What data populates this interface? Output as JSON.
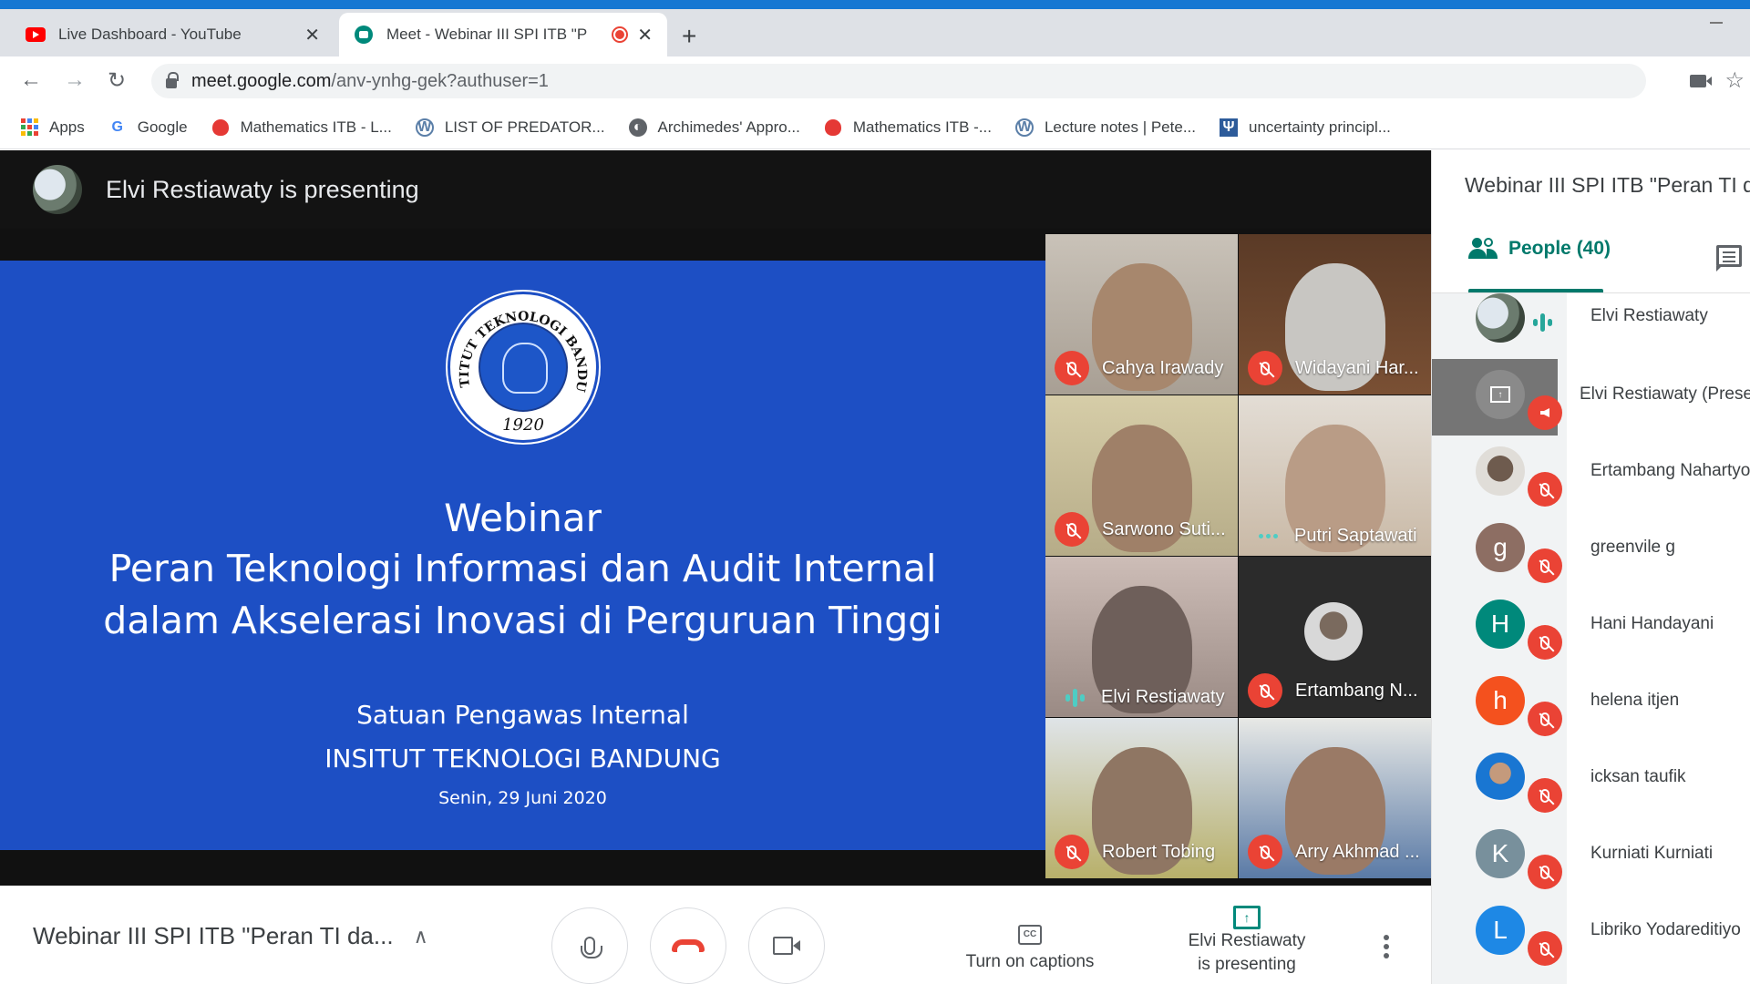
{
  "browser": {
    "tabs": [
      {
        "title": "Live Dashboard - YouTube",
        "favicon": "youtube-icon",
        "active": false
      },
      {
        "title": "Meet - Webinar III SPI ITB \"P",
        "favicon": "google-meet-icon",
        "active": true,
        "recording_indicator": true
      }
    ],
    "new_tab_label": "+",
    "url_host": "meet.google.com",
    "url_path": "/anv-ynhg-gek?authuser=1",
    "bookmarks": [
      {
        "label": "Apps",
        "icon": "apps-grid-icon"
      },
      {
        "label": "Google",
        "icon": "google-icon"
      },
      {
        "label": "Mathematics ITB - L...",
        "icon": "mathematics-itb-icon"
      },
      {
        "label": "LIST OF PREDATOR...",
        "icon": "wordpress-icon"
      },
      {
        "label": "Archimedes' Appro...",
        "icon": "globe-icon"
      },
      {
        "label": "Mathematics ITB -...",
        "icon": "mathematics-itb-icon"
      },
      {
        "label": "Lecture notes | Pete...",
        "icon": "wordpress-icon"
      },
      {
        "label": "uncertainty principl...",
        "icon": "psi-icon"
      }
    ]
  },
  "meeting": {
    "presenting_banner": "Elvi Restiawaty is presenting",
    "slide": {
      "line1": "Webinar",
      "line2": "Peran Teknologi Informasi dan Audit Internal",
      "line3": "dalam Akselerasi Inovasi di Perguruan Tinggi",
      "line4": "Satuan Pengawas Internal",
      "line5": "INSITUT TEKNOLOGI BANDUNG",
      "line6": "Senin, 29 Juni 2020",
      "logo_ring_text": "INSTITUT TEKNOLOGI BANDUNG",
      "logo_year": "1920"
    },
    "tiles": [
      {
        "name": "Cahya Irawady",
        "muted": true
      },
      {
        "name": "Widayani Har...",
        "muted": true
      },
      {
        "name": "Sarwono Suti...",
        "muted": true
      },
      {
        "name": "Putri Saptawati",
        "muted": false
      },
      {
        "name": "Elvi Restiawaty",
        "muted": false,
        "speaking": true
      },
      {
        "name": "Ertambang N...",
        "muted": true
      },
      {
        "name": "Robert Tobing",
        "muted": true
      },
      {
        "name": "Arry Akhmad ...",
        "muted": true
      }
    ],
    "title": "Webinar III SPI ITB \"Peran TI da...",
    "controls": {
      "captions_label": "Turn on captions",
      "presenting_label_1": "Elvi Restiawaty",
      "presenting_label_2": "is presenting"
    }
  },
  "side_panel": {
    "title": "Webinar III SPI ITB \"Peran TI da",
    "people_tab": "People (40)",
    "people": [
      {
        "name": "Elvi Restiawaty",
        "initial": "",
        "status": "speaking"
      },
      {
        "name": "Elvi Restiawaty (Prese",
        "initial": "",
        "status": "presentation-muted"
      },
      {
        "name": "Ertambang Nahartyo",
        "initial": "",
        "status": "muted"
      },
      {
        "name": "greenvile g",
        "initial": "g",
        "status": "muted",
        "color": "#8d6e63"
      },
      {
        "name": "Hani Handayani",
        "initial": "H",
        "status": "muted",
        "color": "#00897b"
      },
      {
        "name": "helena itjen",
        "initial": "h",
        "status": "muted",
        "color": "#f4511e"
      },
      {
        "name": "icksan taufik",
        "initial": "",
        "status": "muted"
      },
      {
        "name": "Kurniati Kurniati",
        "initial": "K",
        "status": "muted",
        "color": "#78909c"
      },
      {
        "name": "Libriko Yodareditiyo",
        "initial": "L",
        "status": "muted",
        "color": "#1e88e5"
      }
    ]
  },
  "colors": {
    "accent": "#00796b",
    "mute_red": "#ea4335",
    "slide_blue": "#1d4fc4",
    "chrome_blue": "#1677d2"
  }
}
